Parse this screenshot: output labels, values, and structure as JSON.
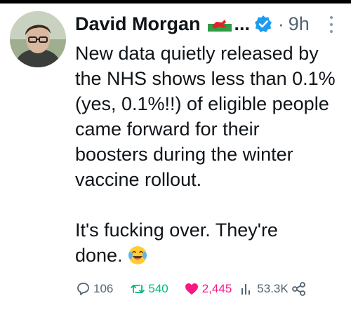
{
  "tweet": {
    "author_name": "David Morgan",
    "truncation": "...",
    "separator": "·",
    "time": "9h",
    "text_lines": [
      "New data quietly released by",
      "the NHS shows less than 0.1%",
      "(yes, 0.1%!!) of eligible people",
      "came forward for their",
      "boosters during the winter",
      "vaccine rollout."
    ],
    "text_line2_prefix": "It's fucking over. They're",
    "text_line3": "done."
  },
  "icons": {
    "flag": "wales-flag-emoji",
    "verified": "verified-badge-icon",
    "more": "more-options-icon",
    "emoji": "face-with-tears-of-joy-emoji",
    "reply": "reply-icon",
    "retweet": "retweet-icon",
    "like": "heart-icon",
    "views": "views-icon",
    "share": "share-icon"
  },
  "actions": {
    "replies": "106",
    "retweets": "540",
    "likes": "2,445",
    "views": "53.3K"
  },
  "colors": {
    "text": "#0f1419",
    "secondary": "#536471",
    "verified": "#1d9bf0",
    "retweet": "#00ba7c",
    "like": "#f91880"
  }
}
